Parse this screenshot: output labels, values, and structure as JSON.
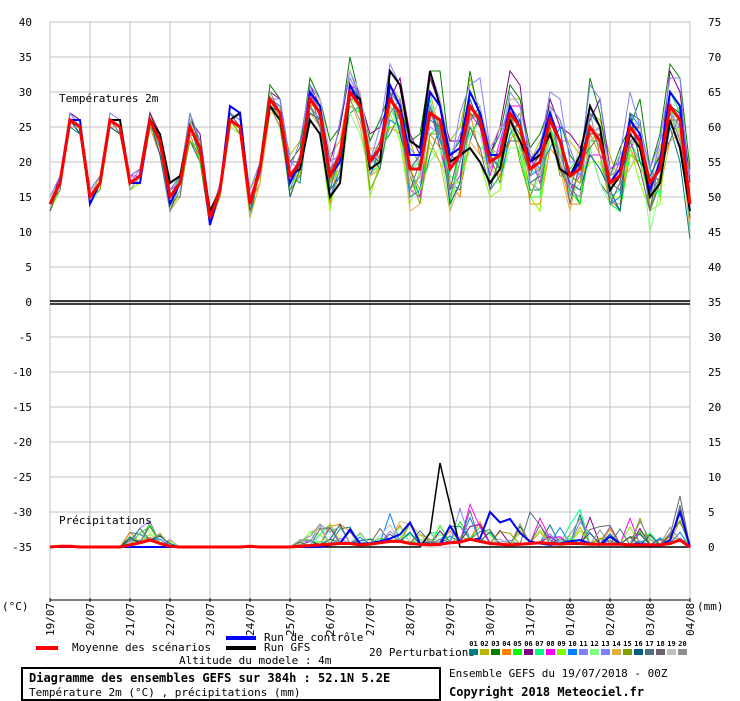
{
  "chart_data": {
    "type": "line",
    "title": "Diagramme des ensembles GEFS sur 384h : 52.1N 5.2E",
    "subtitle": "Température 2m (°C) , précipitations (mm)",
    "run_info": "Ensemble GEFS du 19/07/2018 - 00Z",
    "copyright": "Copyright 2018 Meteociel.fr",
    "altitude": "Altitude du modele : 4m",
    "panel_temp_label": "Températures 2m",
    "panel_precip_label": "Précipitations",
    "left_unit": "(°C)",
    "right_unit": "(mm)",
    "left_ticks": [
      "40",
      "35",
      "30",
      "25",
      "20",
      "15",
      "10",
      "5",
      "0",
      "-5",
      "-10",
      "-15",
      "-20",
      "-25",
      "-30",
      "-35"
    ],
    "right_ticks": [
      "75",
      "70",
      "65",
      "60",
      "55",
      "50",
      "45",
      "40",
      "35",
      "30",
      "25",
      "20",
      "15",
      "10",
      "5",
      "0"
    ],
    "ylim": [
      -35,
      40
    ],
    "precip_offset": -35,
    "x_labels": [
      "19/07",
      "20/07",
      "21/07",
      "22/07",
      "23/07",
      "24/07",
      "25/07",
      "26/07",
      "27/07",
      "28/07",
      "29/07",
      "30/07",
      "31/07",
      "01/08",
      "02/08",
      "03/08",
      "04/08"
    ],
    "time_step_hours": 6,
    "legend": {
      "mean": "Moyenne des scénarios",
      "control": "Run de contrôle",
      "gfs": "Run GFS",
      "perturbations": "20 Perturbations"
    },
    "colors": {
      "mean": "#ff0000",
      "control": "#0000ff",
      "gfs": "#000000",
      "grid": "#c0c0c0"
    },
    "perturbation_ids": [
      "01",
      "02",
      "03",
      "04",
      "05",
      "06",
      "07",
      "08",
      "09",
      "10",
      "11",
      "12",
      "13",
      "14",
      "15",
      "16",
      "17",
      "18",
      "19",
      "20"
    ],
    "perturbation_colors": [
      "#008080",
      "#b8b800",
      "#008000",
      "#ff8000",
      "#00ff00",
      "#800080",
      "#00ff80",
      "#ff00ff",
      "#80ff00",
      "#0080ff",
      "#8080ff",
      "#80ff80",
      "#8080ff",
      "#e0b040",
      "#80a000",
      "#006080",
      "#507080",
      "#706070",
      "#c0c0c0",
      "#909090"
    ],
    "temp_mean": [
      14,
      17,
      26,
      25,
      15,
      17,
      26,
      25,
      17,
      18,
      26,
      23,
      15,
      17,
      25,
      22,
      12,
      16,
      26,
      25,
      14,
      19,
      29,
      27,
      18,
      20,
      29,
      27,
      18,
      21,
      30,
      28,
      20,
      22,
      29,
      27,
      19,
      19,
      27,
      26,
      19,
      21,
      28,
      26,
      20,
      21,
      27,
      25,
      19,
      20,
      26,
      23,
      18,
      19,
      25,
      23,
      17,
      18,
      25,
      23,
      17,
      19,
      28,
      26,
      14
    ],
    "temp_control": [
      14,
      17,
      26,
      26,
      14,
      17,
      26,
      25,
      17,
      17,
      26,
      23,
      14,
      17,
      25,
      22,
      11,
      16,
      28,
      27,
      14,
      19,
      29,
      27,
      17,
      20,
      30,
      28,
      18,
      20,
      31,
      28,
      20,
      22,
      31,
      28,
      21,
      21,
      30,
      28,
      21,
      22,
      30,
      27,
      21,
      21,
      28,
      25,
      20,
      22,
      27,
      23,
      18,
      20,
      25,
      23,
      17,
      19,
      26,
      24,
      16,
      20,
      30,
      28,
      14
    ],
    "temp_gfs": [
      14,
      17,
      26,
      25,
      15,
      17,
      26,
      26,
      17,
      18,
      26,
      24,
      17,
      18,
      25,
      22,
      13,
      16,
      26,
      27,
      14,
      19,
      28,
      26,
      18,
      19,
      26,
      24,
      15,
      17,
      30,
      29,
      19,
      20,
      33,
      31,
      23,
      22,
      33,
      28,
      20,
      21,
      22,
      20,
      17,
      19,
      26,
      23,
      20,
      21,
      24,
      19,
      18,
      21,
      28,
      25,
      16,
      18,
      24,
      22,
      15,
      17,
      26,
      22,
      13
    ],
    "temp_spread": [
      1,
      1,
      1,
      1,
      1,
      1,
      1,
      1,
      1,
      1,
      1,
      2,
      2,
      2,
      2,
      2,
      1,
      1,
      1,
      1,
      2,
      2,
      2,
      2,
      3,
      3,
      3,
      3,
      4,
      4,
      4,
      4,
      4,
      4,
      4,
      4,
      5,
      5,
      5,
      5,
      5,
      5,
      5,
      5,
      5,
      5,
      5,
      5,
      5,
      5,
      5,
      5,
      5,
      5,
      5,
      5,
      5,
      5,
      5,
      5,
      5,
      5,
      5,
      5,
      5
    ],
    "precip_mean": [
      0,
      0.1,
      0.1,
      0,
      0,
      0,
      0,
      0,
      0.3,
      0.6,
      1,
      0.5,
      0.1,
      0,
      0,
      0,
      0,
      0,
      0,
      0,
      0.1,
      0,
      0,
      0,
      0,
      0.1,
      0.2,
      0.3,
      0.4,
      0.5,
      0.5,
      0.3,
      0.4,
      0.6,
      0.8,
      0.8,
      0.5,
      0.4,
      0.3,
      0.4,
      0.6,
      0.7,
      1.1,
      0.8,
      0.5,
      0.4,
      0.3,
      0.4,
      0.5,
      0.6,
      0.5,
      0.4,
      0.5,
      0.5,
      0.4,
      0.4,
      0.4,
      0.4,
      0.3,
      0.3,
      0.3,
      0.3,
      0.5,
      1,
      0
    ],
    "precip_control": [
      0,
      0,
      0,
      0,
      0,
      0,
      0,
      0,
      0,
      0,
      0,
      0,
      0,
      0,
      0,
      0,
      0,
      0,
      0,
      0,
      0,
      0,
      0,
      0,
      0,
      0,
      0,
      0,
      0.3,
      0.5,
      2.5,
      0.5,
      0.5,
      0.8,
      1.2,
      1.8,
      3.5,
      0.5,
      0.4,
      0.3,
      3,
      0.8,
      1,
      1.2,
      5,
      3.5,
      4,
      2,
      0.8,
      0.5,
      0.3,
      0.5,
      0.8,
      1,
      0.5,
      0.3,
      1.5,
      0.5,
      0.3,
      0.5,
      0.2,
      0.2,
      1,
      5,
      0
    ],
    "precip_gfs": [
      0,
      0,
      0,
      0,
      0,
      0,
      0,
      0,
      0,
      0,
      0,
      0,
      0,
      0,
      0,
      0,
      0,
      0,
      0,
      0,
      0,
      0,
      0,
      0,
      0,
      0,
      0,
      0,
      0,
      0,
      0,
      0,
      0,
      0,
      0,
      0,
      0,
      0,
      2,
      12,
      6,
      0,
      0,
      0,
      0,
      0,
      0,
      0,
      0,
      0,
      0,
      0,
      0,
      0,
      0,
      0,
      0,
      0,
      0,
      0,
      0,
      0,
      0,
      0,
      0
    ],
    "precip_spread": [
      0,
      0,
      0,
      0,
      0,
      0,
      0,
      0,
      2,
      3,
      4,
      2,
      1,
      0,
      0,
      0,
      0,
      0,
      0,
      0,
      0,
      0,
      0,
      0,
      0,
      1,
      2,
      3,
      3,
      3,
      3,
      2,
      3,
      4,
      4,
      3,
      3,
      2,
      2,
      3,
      3,
      5,
      6,
      4,
      3,
      2,
      2,
      3,
      6,
      4,
      3,
      3,
      3,
      5,
      4,
      3,
      3,
      4,
      4,
      4,
      2,
      2,
      3,
      7,
      1
    ]
  }
}
